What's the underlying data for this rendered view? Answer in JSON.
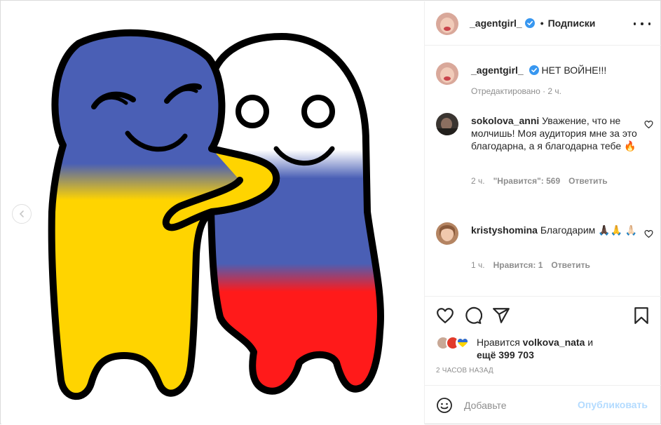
{
  "post_author": {
    "username": "_agentgirl_",
    "follow_status": "Подписки",
    "separator": "•"
  },
  "caption": {
    "username": "_agentgirl_",
    "text": "НЕТ ВОЙНЕ!!!",
    "meta": "Отредактировано · 2 ч."
  },
  "comments": [
    {
      "username": "sokolova_anni",
      "text": "Уважение, что не молчишь! Моя аудитория мне за это благодарна, а я благодарна тебе 🔥",
      "time": "2 ч.",
      "likes": "\"Нравится\": 569",
      "reply": "Ответить"
    },
    {
      "username": "kristyshomina",
      "text": "Благодарим 🙏🏿🙏 🙏🏻",
      "time": "1 ч.",
      "likes": "Нравится: 1",
      "reply": "Ответить"
    }
  ],
  "likes": {
    "prefix": "Нравится",
    "user": "volkova_nata",
    "conj": "и",
    "rest": "ещё 399 703"
  },
  "timestamp": "2 ЧАСОВ НАЗАД",
  "comment_box": {
    "placeholder": "Добавьте",
    "publish_label": "Опубликовать"
  },
  "colors": {
    "accent": "#0095f6",
    "publish_disabled": "#b3dbff",
    "verified": "#3897f0",
    "flag_blue": "#4a5fb5",
    "flag_yellow": "#ffd400",
    "flag_red": "#ff1a1a"
  },
  "icons": [
    "chevron-left-icon",
    "more-icon",
    "verified-icon",
    "heart-icon",
    "comment-icon",
    "share-icon",
    "bookmark-icon",
    "emoji-icon"
  ]
}
